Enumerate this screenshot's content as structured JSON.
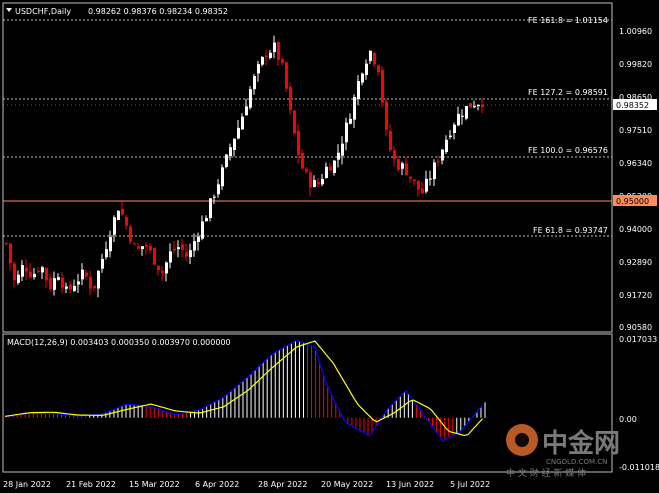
{
  "header": {
    "symbol": "USDCHF,Daily",
    "ohlc": "0.98262 0.98376 0.98234 0.98352"
  },
  "price_axis": {
    "ticks": [
      "1.00960",
      "0.99820",
      "0.98650",
      "0.97510",
      "0.96340",
      "0.95200",
      "0.94000",
      "0.92890",
      "0.91720",
      "0.90580"
    ],
    "current_price": "0.98352",
    "level_label": "0.95000"
  },
  "fe_levels": [
    {
      "label": "FE 161.8 = 1.01154",
      "value": 1.01154
    },
    {
      "label": "FE 127.2 = 0.98591",
      "value": 0.98591
    },
    {
      "label": "FE 100.0 = 0.96576",
      "value": 0.96576
    },
    {
      "label": "FE 61.8 = 0.93747",
      "value": 0.93747
    }
  ],
  "macd": {
    "title": "MACD(12,26,9) 0.003403 0.000350 0.003970 0.000000",
    "ticks": [
      "0.017033",
      "0.00",
      "-0.011018"
    ]
  },
  "time_axis": {
    "labels": [
      "28 Jan 2022",
      "21 Feb 2022",
      "15 Mar 2022",
      "6 Apr 2022",
      "28 Apr 2022",
      "20 May 2022",
      "13 Jun 2022",
      "5 Jul 2022"
    ]
  },
  "watermark": {
    "brand": "中金网",
    "domain": "CNGOLD.COM.CN",
    "slogan": "中 文 财 经 新 媒 体"
  },
  "colors": {
    "background": "#000000",
    "bull": "#ffffff",
    "bear": "#ff0000",
    "grid": "#bfbfbf",
    "level_line": "#ff8c5a",
    "macd_line": "#0000ff",
    "signal_line": "#ffff00"
  },
  "chart_data": {
    "type": "candlestick",
    "symbol": "USDCHF",
    "timeframe": "Daily",
    "ylim": [
      0.9058,
      1.0154
    ],
    "path_points": [
      [
        0,
        0.935
      ],
      [
        6,
        0.921
      ],
      [
        12,
        0.928
      ],
      [
        18,
        0.924
      ],
      [
        24,
        0.928
      ],
      [
        30,
        0.92
      ],
      [
        36,
        0.925
      ],
      [
        42,
        0.918
      ],
      [
        48,
        0.922
      ],
      [
        54,
        0.925
      ],
      [
        60,
        0.919
      ],
      [
        66,
        0.929
      ],
      [
        72,
        0.939
      ],
      [
        78,
        0.948
      ],
      [
        84,
        0.94
      ],
      [
        90,
        0.932
      ],
      [
        96,
        0.935
      ],
      [
        102,
        0.93
      ],
      [
        108,
        0.925
      ],
      [
        114,
        0.932
      ],
      [
        120,
        0.934
      ],
      [
        126,
        0.93
      ],
      [
        132,
        0.938
      ],
      [
        138,
        0.944
      ],
      [
        144,
        0.952
      ],
      [
        150,
        0.96
      ],
      [
        156,
        0.969
      ],
      [
        162,
        0.976
      ],
      [
        168,
        0.986
      ],
      [
        174,
        0.994
      ],
      [
        180,
        1.0
      ],
      [
        186,
        1.002
      ],
      [
        192,
        0.994
      ],
      [
        198,
        0.976
      ],
      [
        204,
        0.962
      ],
      [
        210,
        0.956
      ],
      [
        216,
        0.955
      ],
      [
        222,
        0.961
      ],
      [
        228,
        0.963
      ],
      [
        234,
        0.972
      ],
      [
        240,
        0.982
      ],
      [
        246,
        0.994
      ],
      [
        252,
        1.001
      ],
      [
        258,
        0.995
      ],
      [
        264,
        0.97
      ],
      [
        270,
        0.962
      ],
      [
        276,
        0.961
      ],
      [
        282,
        0.956
      ],
      [
        288,
        0.952
      ],
      [
        294,
        0.958
      ],
      [
        300,
        0.965
      ],
      [
        306,
        0.972
      ],
      [
        312,
        0.978
      ],
      [
        318,
        0.981
      ],
      [
        324,
        0.983
      ],
      [
        330,
        0.9835
      ]
    ],
    "macd_path": [
      [
        0,
        0.0002
      ],
      [
        20,
        0.001
      ],
      [
        40,
        0.0009
      ],
      [
        60,
        0.0004
      ],
      [
        80,
        0.0008
      ],
      [
        100,
        0.003
      ],
      [
        120,
        0.0025
      ],
      [
        140,
        0.0006
      ],
      [
        160,
        0.0017
      ],
      [
        180,
        0.0045
      ],
      [
        200,
        0.009
      ],
      [
        220,
        0.014
      ],
      [
        240,
        0.017
      ],
      [
        255,
        0.0155
      ],
      [
        265,
        0.007
      ],
      [
        280,
        -0.001
      ],
      [
        300,
        -0.004
      ],
      [
        315,
        0.002
      ],
      [
        330,
        0.006
      ],
      [
        345,
        0.0005
      ],
      [
        360,
        -0.005
      ],
      [
        375,
        -0.003
      ],
      [
        395,
        0.0034
      ]
    ],
    "signal_path": [
      [
        0,
        0.0003
      ],
      [
        20,
        0.0011
      ],
      [
        40,
        0.0012
      ],
      [
        60,
        0.0006
      ],
      [
        80,
        0.0005
      ],
      [
        100,
        0.0018
      ],
      [
        120,
        0.003
      ],
      [
        140,
        0.0015
      ],
      [
        160,
        0.001
      ],
      [
        180,
        0.0024
      ],
      [
        200,
        0.006
      ],
      [
        220,
        0.011
      ],
      [
        240,
        0.0155
      ],
      [
        255,
        0.0168
      ],
      [
        270,
        0.012
      ],
      [
        290,
        0.003
      ],
      [
        305,
        -0.001
      ],
      [
        320,
        0.001
      ],
      [
        335,
        0.004
      ],
      [
        350,
        0.002
      ],
      [
        365,
        -0.003
      ],
      [
        380,
        -0.004
      ],
      [
        395,
        0.0004
      ]
    ]
  }
}
